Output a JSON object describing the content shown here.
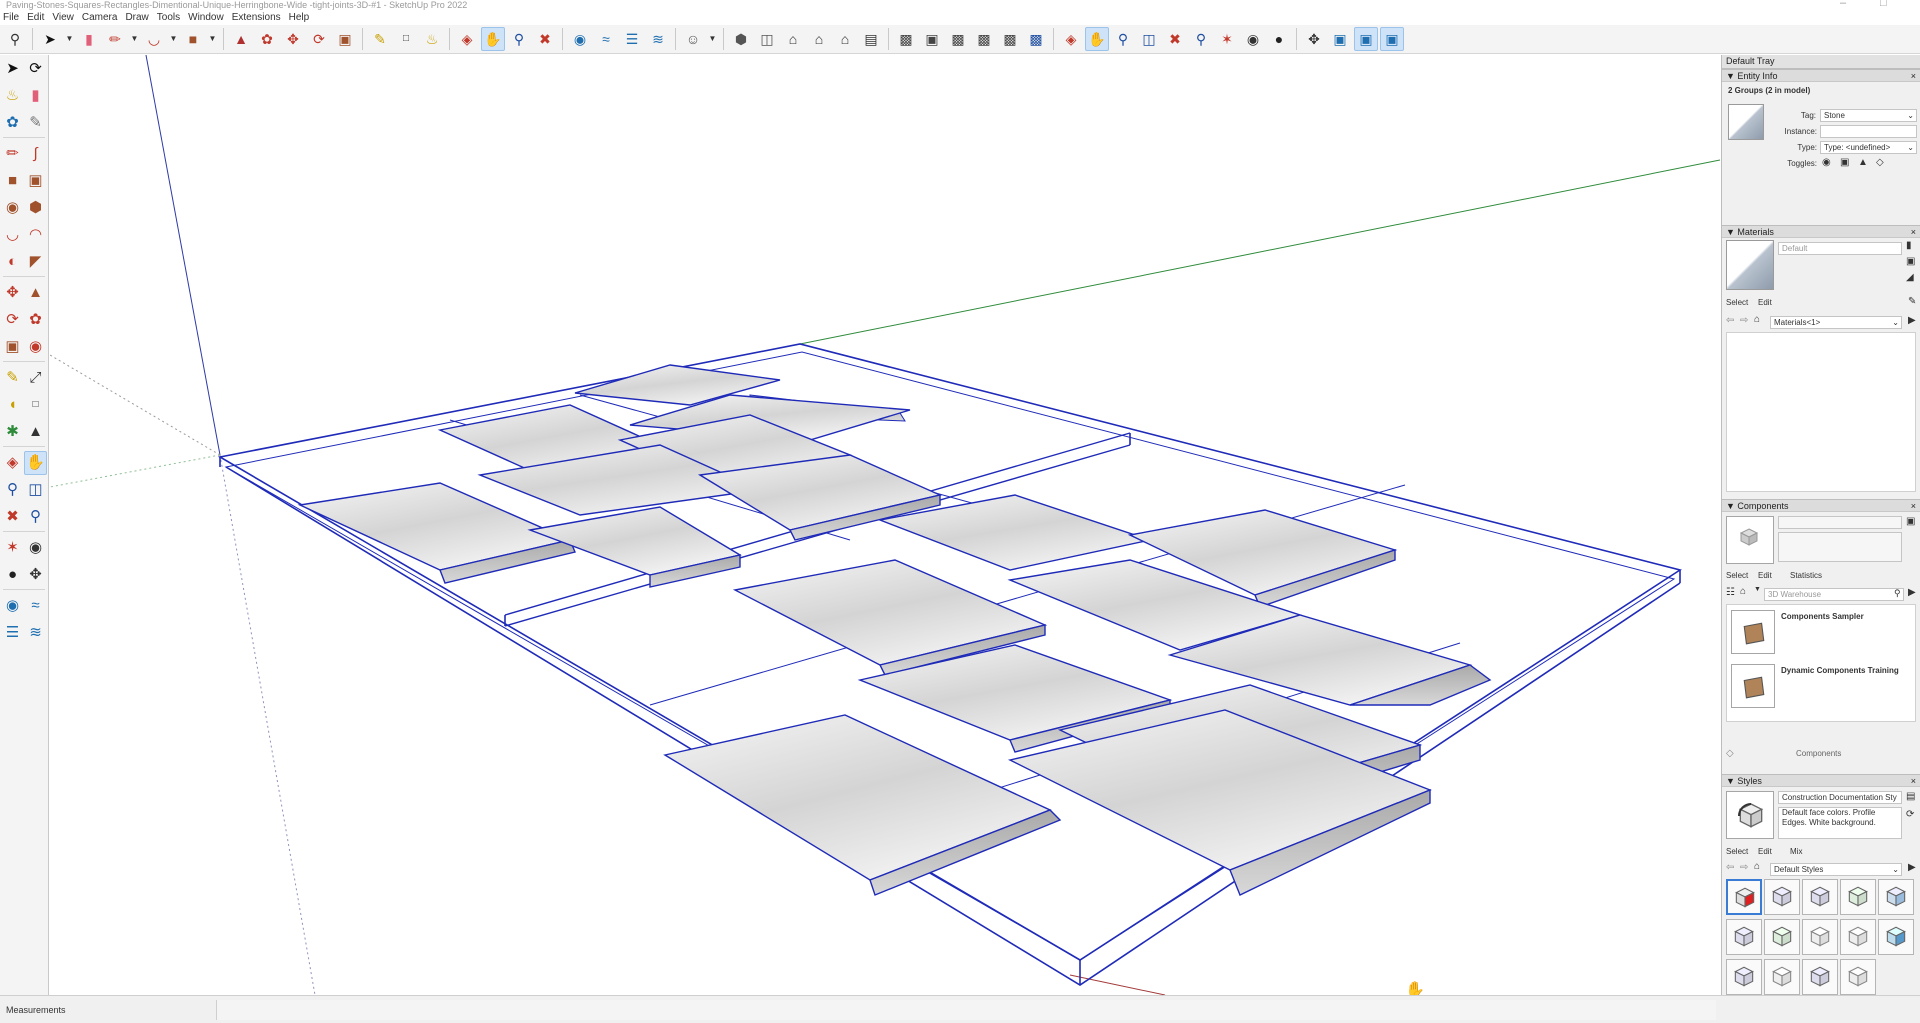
{
  "window": {
    "title": "Paving-Stones-Squares-Rectangles-Dimentional-Unique-Herringbone-Wide -tight-joints-3D-#1 - SketchUp Pro 2022",
    "controls": [
      "–",
      "□"
    ]
  },
  "menu": [
    "File",
    "Edit",
    "View",
    "Camera",
    "Draw",
    "Tools",
    "Window",
    "Extensions",
    "Help"
  ],
  "colors": {
    "edge_blue": "#1f2bb8",
    "green_axis": "#2e8b3a",
    "red_axis": "#a33a3a",
    "toolbar_bg": "#f4f4f4",
    "tray_bg": "#f0f0f0",
    "active_tool": "#cfe3f8"
  },
  "top_toolbar_icons": [
    "search-icon",
    "select-icon",
    "dropdown",
    "eraser-icon",
    "line-icon",
    "dropdown",
    "arc-icon",
    "dropdown",
    "rectangle-icon",
    "dropdown",
    "push-pull-icon",
    "follow-me-icon",
    "move-icon",
    "rotate-icon",
    "scale-icon",
    "tape-measure-icon",
    "text-icon",
    "paint-bucket-icon",
    "orbit-icon",
    "pan-icon",
    "zoom-icon",
    "zoom-extents-icon",
    "warehouse-icon",
    "share-icon",
    "layout-icon",
    "extensions-icon",
    "user-icon",
    "dropdown",
    "iso-view-icon",
    "top-view-icon",
    "front-view-icon",
    "right-view-icon",
    "back-view-icon",
    "left-view-icon",
    "xray-icon",
    "wireframe-icon",
    "hidden-line-icon",
    "shaded-icon",
    "textured-icon",
    "monochrome-icon",
    "orbit-icon",
    "pan-icon",
    "zoom-icon",
    "zoom-window-icon",
    "zoom-extents-icon",
    "previous-icon",
    "position-camera-icon",
    "look-around-icon",
    "walk-icon",
    "section-plane-icon",
    "section-display-icon",
    "section-cut-icon",
    "section-fill-icon"
  ],
  "tray": {
    "title": "Default Tray",
    "entity_info": {
      "header": "Entity Info",
      "summary": "2 Groups (2 in model)",
      "tag_label": "Tag:",
      "tag_value": "Stone",
      "instance_label": "Instance:",
      "instance_value": "",
      "type_label": "Type:",
      "type_value": "Type: <undefined>",
      "toggles_label": "Toggles:"
    },
    "materials": {
      "header": "Materials",
      "name_value": "Default",
      "tab_select": "Select",
      "tab_edit": "Edit",
      "collection": "Materials<1>"
    },
    "components": {
      "header": "Components",
      "tab_select": "Select",
      "tab_edit": "Edit",
      "tab_statistics": "Statistics",
      "search_placeholder": "3D Warehouse",
      "items": [
        {
          "name": "Components Sampler"
        },
        {
          "name": "Dynamic Components Training"
        }
      ],
      "footer": "Components"
    },
    "styles": {
      "header": "Styles",
      "style_name": "Construction Documentation Sty",
      "style_description": "Default face colors. Profile Edges. White background.",
      "tab_select": "Select",
      "tab_edit": "Edit",
      "tab_mix": "Mix",
      "collection": "Default Styles"
    }
  },
  "status": {
    "measurements_label": "Measurements"
  }
}
